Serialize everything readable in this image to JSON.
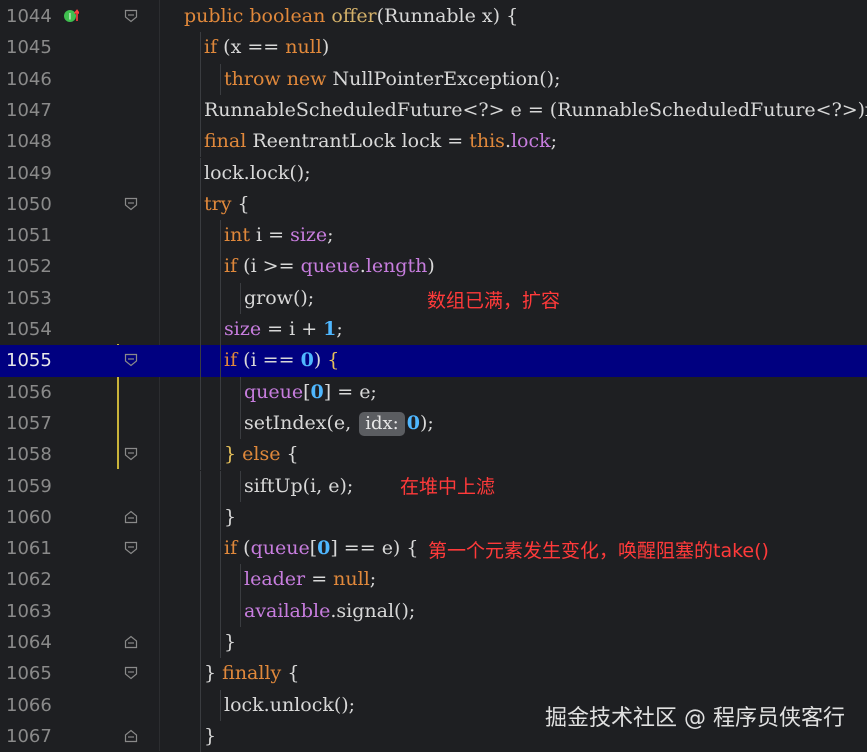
{
  "lines": [
    {
      "num": "1044",
      "tokens": [
        [
          "kw",
          "public boolean "
        ],
        [
          "fn",
          "offer"
        ],
        [
          "plain",
          "(Runnable x) {"
        ]
      ]
    },
    {
      "num": "1045",
      "tokens": [
        [
          "kw",
          "if "
        ],
        [
          "plain",
          "(x == "
        ],
        [
          "kw",
          "null"
        ],
        [
          "plain",
          ")"
        ]
      ]
    },
    {
      "num": "1046",
      "tokens": [
        [
          "kw",
          "throw new "
        ],
        [
          "plain",
          "NullPointerException();"
        ]
      ]
    },
    {
      "num": "1047",
      "tokens": [
        [
          "plain",
          "RunnableScheduledFuture<?> e = (RunnableScheduledFuture<?>)x;"
        ]
      ]
    },
    {
      "num": "1048",
      "tokens": [
        [
          "kw",
          "final "
        ],
        [
          "plain",
          "ReentrantLock lock = "
        ],
        [
          "kw",
          "this"
        ],
        [
          "plain",
          "."
        ],
        [
          "fld",
          "lock"
        ],
        [
          "plain",
          ";"
        ]
      ]
    },
    {
      "num": "1049",
      "tokens": [
        [
          "plain",
          "lock.lock();"
        ]
      ]
    },
    {
      "num": "1050",
      "tokens": [
        [
          "kw",
          "try "
        ],
        [
          "plain",
          "{"
        ]
      ]
    },
    {
      "num": "1051",
      "tokens": [
        [
          "kw",
          "int "
        ],
        [
          "plain",
          "i = "
        ],
        [
          "fld",
          "size"
        ],
        [
          "plain",
          ";"
        ]
      ]
    },
    {
      "num": "1052",
      "tokens": [
        [
          "kw",
          "if "
        ],
        [
          "plain",
          "(i >= "
        ],
        [
          "fld",
          "queue"
        ],
        [
          "plain",
          "."
        ],
        [
          "fld",
          "length"
        ],
        [
          "plain",
          ")"
        ]
      ]
    },
    {
      "num": "1053",
      "tokens": [
        [
          "plain",
          "grow();"
        ]
      ]
    },
    {
      "num": "1054",
      "tokens": [
        [
          "fld",
          "size "
        ],
        [
          "plain",
          "= i + "
        ],
        [
          "num",
          "1"
        ],
        [
          "plain",
          ";"
        ]
      ]
    },
    {
      "num": "1055",
      "tokens": [
        [
          "kw",
          "if "
        ],
        [
          "plain",
          "(i == "
        ],
        [
          "num",
          "0"
        ],
        [
          "plain",
          ") "
        ],
        [
          "brk",
          "{"
        ]
      ]
    },
    {
      "num": "1056",
      "tokens": [
        [
          "fld",
          "queue"
        ],
        [
          "plain",
          "["
        ],
        [
          "num",
          "0"
        ],
        [
          "plain",
          "] = e;"
        ]
      ]
    },
    {
      "num": "1057",
      "tokens": [
        [
          "plain",
          "setIndex(e, "
        ],
        [
          "hint",
          "idx:"
        ],
        [
          "num",
          "0"
        ],
        [
          "plain",
          ");"
        ]
      ]
    },
    {
      "num": "1058",
      "tokens": [
        [
          "brk",
          "} "
        ],
        [
          "kw",
          "else "
        ],
        [
          "plain",
          "{"
        ]
      ]
    },
    {
      "num": "1059",
      "tokens": [
        [
          "plain",
          "siftUp(i, e);"
        ]
      ]
    },
    {
      "num": "1060",
      "tokens": [
        [
          "plain",
          "}"
        ]
      ]
    },
    {
      "num": "1061",
      "tokens": [
        [
          "kw",
          "if "
        ],
        [
          "plain",
          "("
        ],
        [
          "fld",
          "queue"
        ],
        [
          "plain",
          "["
        ],
        [
          "num",
          "0"
        ],
        [
          "plain",
          "] == e) {"
        ]
      ]
    },
    {
      "num": "1062",
      "tokens": [
        [
          "fld",
          "leader "
        ],
        [
          "plain",
          "= "
        ],
        [
          "kw",
          "null"
        ],
        [
          "plain",
          ";"
        ]
      ]
    },
    {
      "num": "1063",
      "tokens": [
        [
          "fld",
          "available"
        ],
        [
          "plain",
          ".signal();"
        ]
      ]
    },
    {
      "num": "1064",
      "tokens": [
        [
          "plain",
          "}"
        ]
      ]
    },
    {
      "num": "1065",
      "tokens": [
        [
          "plain",
          "} "
        ],
        [
          "kw",
          "finally "
        ],
        [
          "plain",
          "{"
        ]
      ]
    },
    {
      "num": "1066",
      "tokens": [
        [
          "plain",
          "lock.unlock();"
        ]
      ]
    },
    {
      "num": "1067",
      "tokens": [
        [
          "plain",
          "}"
        ]
      ]
    }
  ],
  "annotations": {
    "grow": "数组已满，扩容",
    "siftup": "在堆中上滤",
    "signal": "第一个元素发生变化，唤醒阻塞的take()"
  },
  "watermark": "掘金技术社区 @ 程序员侠客行",
  "colors": {
    "background": "#1e1f22",
    "keyword": "#e0883b",
    "method": "#d5b26a",
    "field": "#c77dde",
    "number": "#4fb7ff",
    "annotation": "#ff3a3a",
    "current_line": "#000080"
  }
}
